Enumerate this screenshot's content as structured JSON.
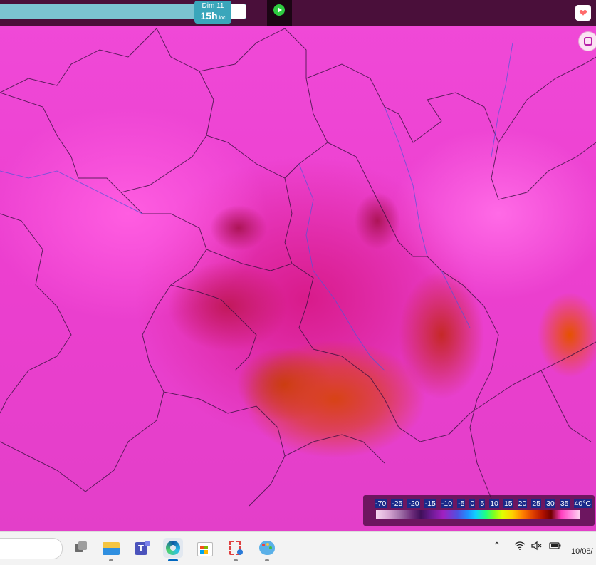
{
  "topbar": {
    "time": {
      "day": "Dim 11",
      "hour": "15h",
      "suffix": "loc"
    }
  },
  "legend": {
    "labels": [
      "-70",
      "-25",
      "-20",
      "-15",
      "-10",
      "-5",
      "0",
      "5",
      "10",
      "15",
      "20",
      "25",
      "30",
      "35",
      "40°C"
    ]
  },
  "taskbar": {
    "apps": [
      "task-view-icon",
      "file-explorer-icon",
      "teams-icon",
      "edge-icon",
      "store-icon",
      "snipping-tool-icon",
      "paint-icon"
    ],
    "tray": {
      "wifi": "wifi-icon",
      "volume": "volume-muted-icon",
      "battery": "battery-icon"
    },
    "clock": "10/08/"
  },
  "colors": {
    "topbar": "#4a0f3a",
    "timeline": "#7bc3d1",
    "badge": "#3aa6bb",
    "play": "#2ecc40"
  }
}
